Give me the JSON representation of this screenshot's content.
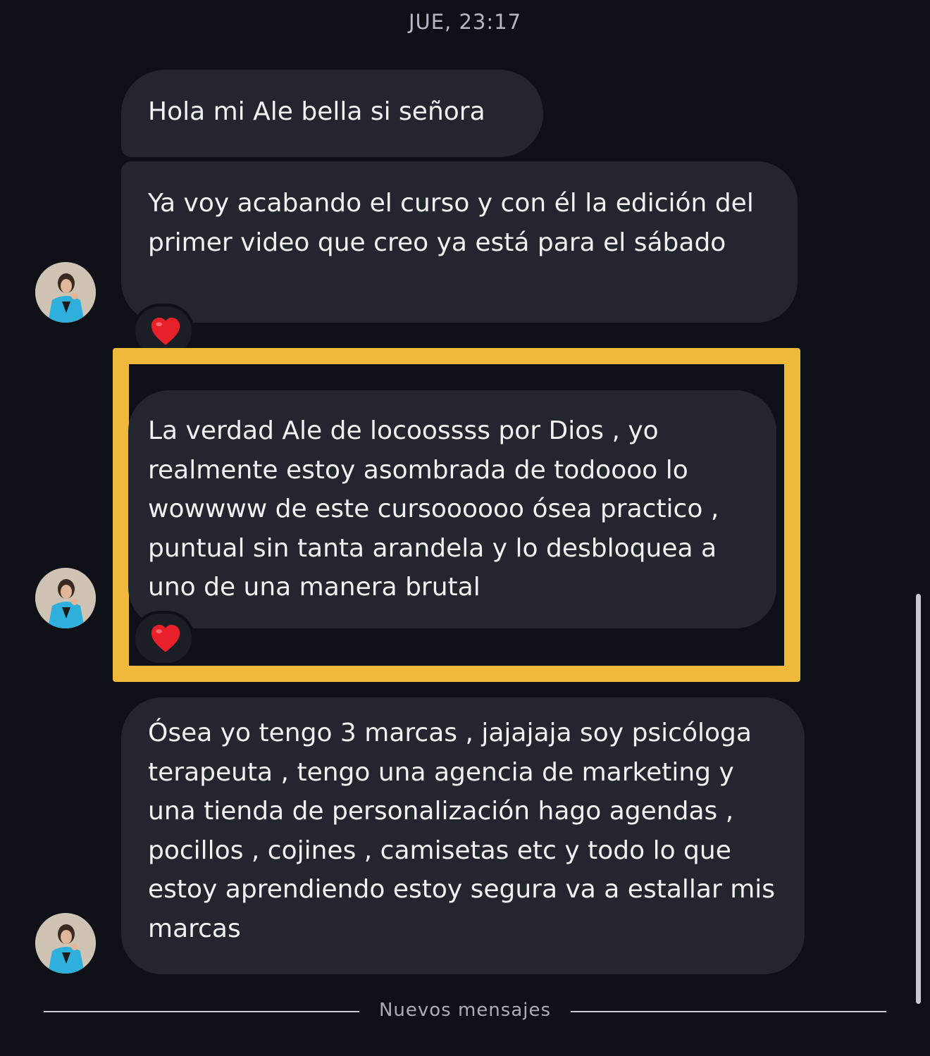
{
  "header": {
    "timestamp": "JUE, 23:17"
  },
  "messages": [
    {
      "text": "Hola mi Ale bella si señora"
    },
    {
      "text": "Ya voy acabando el curso y con él la edición del primer video que creo ya está para el sábado",
      "reaction": "heart-icon"
    },
    {
      "text": "La verdad Ale de locoossss por Dios , yo realmente estoy asombrada de todoooo lo wowwww de este cursoooooo ósea practico , puntual sin tanta arandela y lo desbloquea a uno de una manera brutal",
      "reaction": "heart-icon",
      "highlighted": true
    },
    {
      "text": "Ósea yo tengo 3 marcas , jajajaja soy psicóloga terapeuta , tengo una agencia de marketing y una tienda de personalización hago agendas , pocillos , cojines , camisetas etc y todo lo que estoy aprendiendo estoy segura va a estallar mis marcas"
    }
  ],
  "divider": {
    "label": "Nuevos mensajes"
  },
  "colors": {
    "background": "#0d1117",
    "bubble": "#23262e",
    "highlight": "#f1b93b",
    "heart": "#e8202a",
    "avatar_jacket": "#2fb0dc"
  }
}
